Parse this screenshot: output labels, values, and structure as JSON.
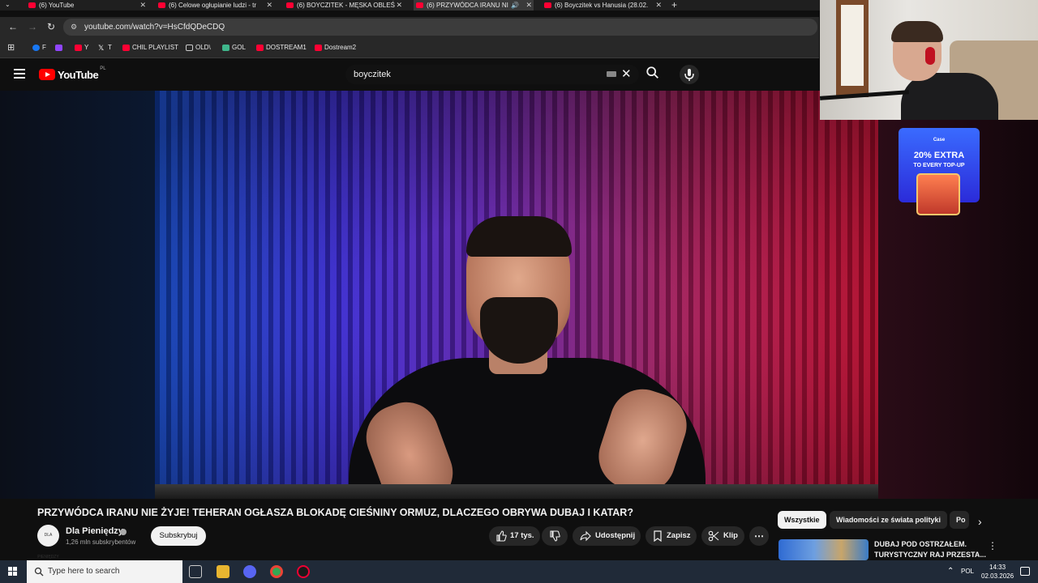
{
  "browser": {
    "tabs": [
      {
        "label": "(6) YouTube",
        "active": false
      },
      {
        "label": "(6) Celowe ogłupianie ludzi - tr",
        "active": false
      },
      {
        "label": "(6) BOYCZITEK - MĘSKA OBLEŚ",
        "active": false
      },
      {
        "label": "(6) PRZYWÓDCA IRANU NI",
        "active": true
      },
      {
        "label": "(6) Boyczitek vs Hanusia (28.02.",
        "active": false
      }
    ],
    "url": "youtube.com/watch?v=HsCfdQDeCDQ",
    "bookmarks": [
      {
        "label": "F",
        "color": "#1877f2"
      },
      {
        "label": "",
        "color": "#9146ff"
      },
      {
        "label": "Y",
        "color": "#ff0033"
      },
      {
        "label": "T",
        "color": "#ffffff"
      },
      {
        "label": "CHIL PLAYLIST",
        "color": "#ff0033"
      },
      {
        "label": "OLD\\",
        "color": "#cccccc"
      },
      {
        "label": "GOL",
        "color": "#3fb68b"
      },
      {
        "label": "DOSTREAM1",
        "color": "#ff0033"
      },
      {
        "label": "Dostream2",
        "color": "#ff0033"
      }
    ]
  },
  "youtube": {
    "logo_text": "YouTube",
    "region": "PL",
    "search_value": "boyczitek"
  },
  "ad": {
    "brand": "Case",
    "line1": "20% EXTRA",
    "line2": "TO EVERY TOP-UP"
  },
  "video": {
    "title": "PRZYWÓDCA IRANU NIE ŻYJE! TEHERAN OGŁASZA BLOKADĘ CIEŚNINY ORMUZ, DLACZEGO OBRYWA DUBAJ I KATAR?",
    "channel_name": "Dla Pieniędzy",
    "avatar_text": "DLA PIENIĘDZY",
    "subscribers": "1,26 mln subskrybentów",
    "subscribe_label": "Subskrybuj",
    "likes": "17 tys.",
    "share_label": "Udostępnij",
    "save_label": "Zapisz",
    "clip_label": "Klip"
  },
  "sidebar": {
    "chips": [
      "Wszystkie",
      "Wiadomości ze świata polityki",
      "Po"
    ],
    "rec_title": "DUBAJ POD OSTRZAŁEM. TURYSTYCZNY RAJ PRZESTA..."
  },
  "taskbar": {
    "search_placeholder": "Type here to search",
    "language": "POL",
    "time": "14:33",
    "date": "02.03.2026"
  }
}
